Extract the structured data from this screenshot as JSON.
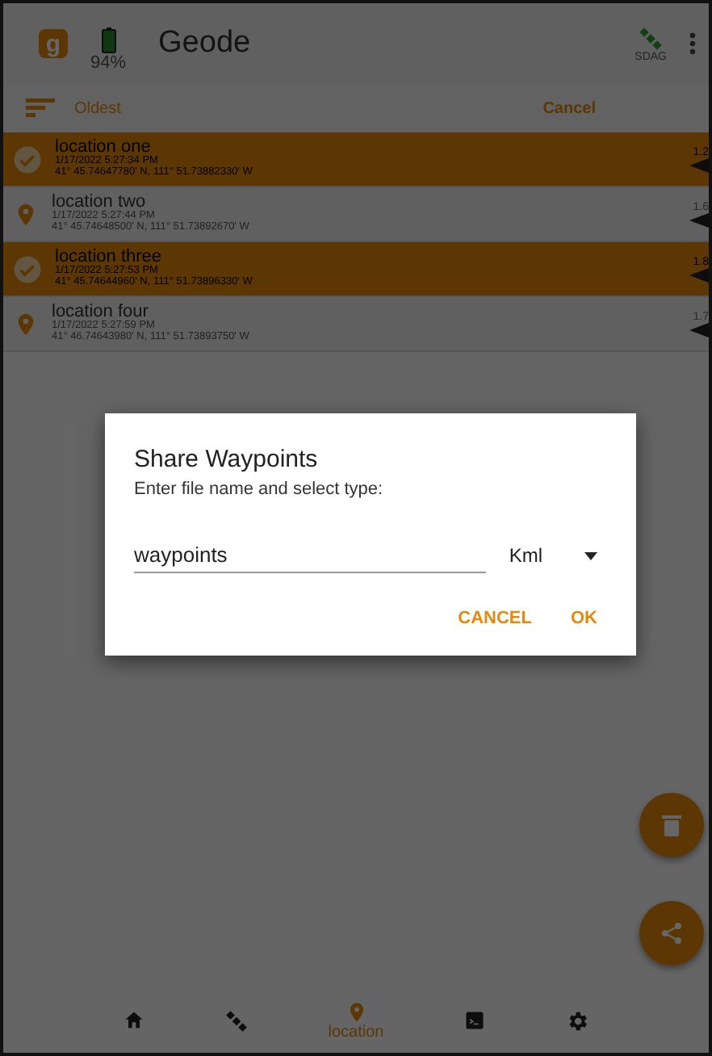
{
  "app_bar": {
    "logo": "g",
    "title": "Geode",
    "battery": "94%",
    "gps_label": "SDAG"
  },
  "sort_bar": {
    "sort": "Oldest",
    "action": "Cancel"
  },
  "locations": [
    {
      "name": "location one",
      "time": "1/17/2022 5:27:34 PM",
      "coords": "41° 45.74647780' N, 111° 51.73882330' W",
      "distance": "1.2",
      "selected": true
    },
    {
      "name": "location two",
      "time": "1/17/2022 5:27:44 PM",
      "coords": "41° 45.74648500' N, 111° 51.73892670' W",
      "distance": "1.6",
      "selected": false
    },
    {
      "name": "location three",
      "time": "1/17/2022 5:27:53 PM",
      "coords": "41° 45.74644960' N, 111° 51.73896330' W",
      "distance": "1.8",
      "selected": true
    },
    {
      "name": "location four",
      "time": "1/17/2022 5:27:59 PM",
      "coords": "41° 46.74643980' N, 111° 51.73893750' W",
      "distance": "1.7",
      "selected": false
    }
  ],
  "dialog": {
    "title": "Share Waypoints",
    "message": "Enter file name and select type:",
    "file_name": "waypoints",
    "file_type": "Kml",
    "buttons": [
      "CANCEL",
      "OK"
    ]
  },
  "bottom_nav": [
    {
      "kind": "home",
      "selected": false
    },
    {
      "kind": "satellite",
      "selected": false
    },
    {
      "kind": "location",
      "label": "location",
      "selected": true
    },
    {
      "kind": "terminal",
      "selected": false
    },
    {
      "kind": "settings",
      "selected": false
    }
  ]
}
